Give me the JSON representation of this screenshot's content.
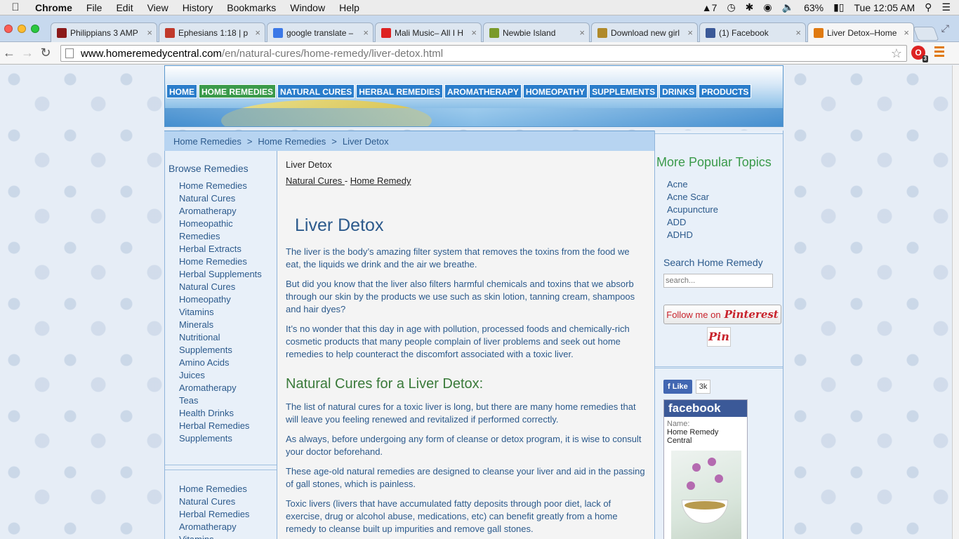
{
  "menubar": {
    "app": "Chrome",
    "items": [
      "File",
      "Edit",
      "View",
      "History",
      "Bookmarks",
      "Window",
      "Help"
    ],
    "status": {
      "adobe_count": "7",
      "battery": "63%",
      "clock": "Tue 12:05 AM"
    }
  },
  "tabs": [
    {
      "title": "Philippians 3 AMP",
      "icon_color": "#8b1a1a",
      "icon": "bible-icon"
    },
    {
      "title": "Ephesians 1:18 | p",
      "icon_color": "#c0392b",
      "icon": "cross-icon"
    },
    {
      "title": "google translate –",
      "icon_color": "#3b78e7",
      "icon": "google-icon"
    },
    {
      "title": "Mali Music– All I H",
      "icon_color": "#d22",
      "icon": "youtube-icon"
    },
    {
      "title": "Newbie Island",
      "icon_color": "#7a9a2a",
      "icon": "cube-icon"
    },
    {
      "title": "Download new girl",
      "icon_color": "#b08a2a",
      "icon": "shield-icon"
    },
    {
      "title": "(1) Facebook",
      "icon_color": "#3b5998",
      "icon": "facebook-icon"
    },
    {
      "title": "Liver Detox–Home",
      "icon_color": "#e07a10",
      "icon": "sun-icon"
    }
  ],
  "omnibox": {
    "host": "www.homeremedycentral.com",
    "path": "/en/natural-cures/home-remedy/liver-detox.html"
  },
  "extension_badge": "3",
  "site": {
    "nav": [
      "HOME",
      "HOME REMEDIES",
      "NATURAL CURES",
      "HERBAL REMEDIES",
      "AROMATHERAPY",
      "HOMEOPATHY",
      "SUPPLEMENTS",
      "DRINKS",
      "PRODUCTS"
    ],
    "breadcrumb": [
      "Home Remedies",
      "Home Remedies",
      "Liver Detox"
    ],
    "browse_title": "Browse Remedies",
    "browse_items": [
      "Home Remedies",
      "Natural Cures",
      "Aromatherapy",
      "Homeopathic",
      "Remedies",
      "Herbal Extracts",
      "Home Remedies",
      "Herbal Supplements",
      "Natural Cures",
      "Homeopathy",
      "Vitamins",
      "Minerals",
      "Nutritional",
      "Supplements",
      "Amino Acids",
      "Juices",
      "Aromatherapy",
      "Teas",
      "Health Drinks",
      "Herbal Remedies",
      "Supplements"
    ],
    "browse_items2": [
      "Home Remedies",
      "Natural Cures",
      "Herbal Remedies",
      "Aromatherapy",
      "Vitamins"
    ],
    "content": {
      "crumb_title": "Liver Detox",
      "link1": "Natural Cures ",
      "link_sep": " - ",
      "link2": "Home Remedy",
      "title": "Liver Detox",
      "p1": "The liver is the body’s amazing filter system that removes the toxins from the food we eat, the liquids we drink and the air we breathe.",
      "p2": "But did you know that the liver also filters harmful chemicals and toxins that we absorb through our skin by the products we use such as skin lotion, tanning cream, shampoos and hair dyes?",
      "p3": "It’s no wonder that this day in age with pollution, processed foods and chemically-rich cosmetic products that many people complain of liver problems and seek out home remedies to help counteract the discomfort associated with a toxic liver.",
      "h2": "Natural Cures for a Liver Detox:",
      "p4": "The list of natural cures for a toxic liver is long, but there are many home remedies that will leave you feeling renewed and revitalized if performed correctly.",
      "p5": "As always, before undergoing any form of cleanse or detox program, it is wise to consult your doctor beforehand.",
      "p6": "These age-old natural remedies are designed to cleanse your liver and aid in the passing of gall stones, which is painless.",
      "p7": "Toxic livers (livers that have accumulated fatty deposits through poor diet, lack of exercise, drug or alcohol abuse, medications, etc) can benefit greatly from a home remedy to cleanse built up impurities and remove gall stones."
    },
    "popular_title": "More Popular Topics",
    "popular_items": [
      "Acne",
      "Acne Scar",
      "Acupuncture",
      "ADD",
      "ADHD"
    ],
    "search_title": "Search Home Remedy",
    "search_placeholder": "search...",
    "pinterest_follow": "Follow me on",
    "pinterest_word": "Pinterest",
    "pin_label": "Pin",
    "fb_like": "Like",
    "fb_count": "3k",
    "fb_brand": "facebook",
    "fb_name_label": "Name:",
    "fb_name": "Home Remedy Central"
  }
}
